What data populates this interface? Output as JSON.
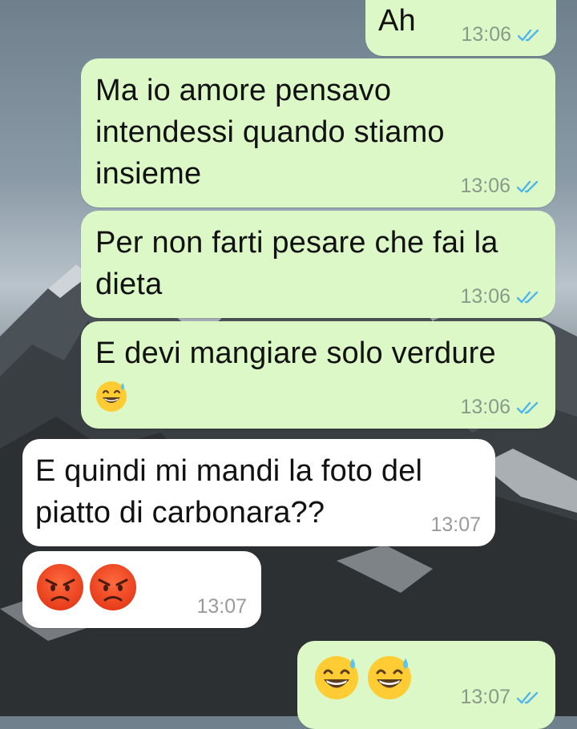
{
  "messages": [
    {
      "text": "Ah",
      "time": "13:06",
      "side": "out"
    },
    {
      "text": "Ma io amore pensavo intendessi quando stiamo insieme",
      "time": "13:06",
      "side": "out"
    },
    {
      "text": "Per non farti pesare che fai la dieta",
      "time": "13:06",
      "side": "out"
    },
    {
      "text": "E devi mangiare solo verdure",
      "time": "13:06",
      "side": "out",
      "emoji": "sweat-smile-emoji"
    },
    {
      "text": "E quindi mi mandi la foto del piatto di carbonara??",
      "time": "13:07",
      "side": "in"
    },
    {
      "time": "13:07",
      "side": "in",
      "emoji": "angry-face-emoji x2"
    },
    {
      "time": "13:07",
      "side": "out",
      "emoji": "sweat-smile-emoji x2"
    }
  ],
  "colors": {
    "outgoing_bubble": "#dcf8c6",
    "incoming_bubble": "#ffffff",
    "read_check": "#4fb6ec"
  }
}
